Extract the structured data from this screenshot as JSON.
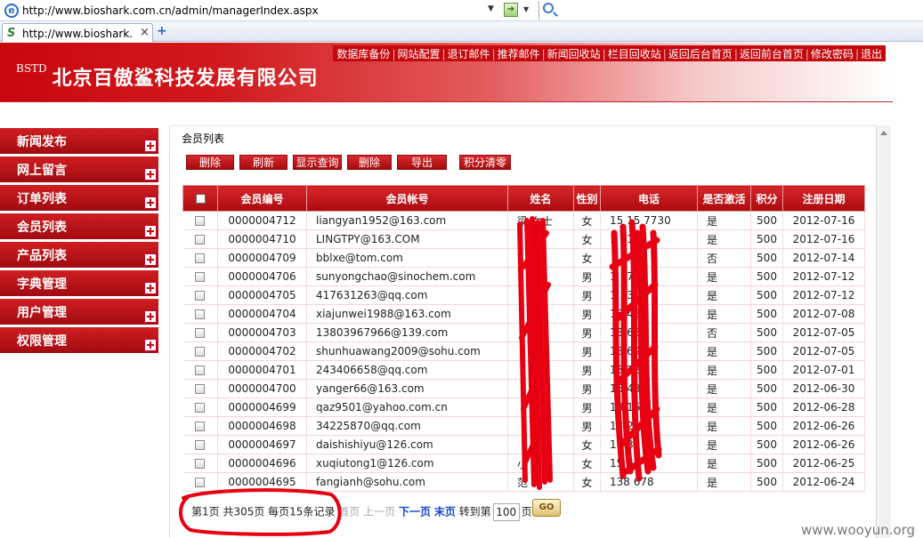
{
  "browser": {
    "url": "http://www.bioshark.com.cn/admin/managerIndex.aspx",
    "tab_title": "http://www.bioshark.",
    "tab_close": "×",
    "new_tab": "+"
  },
  "header": {
    "top_links": [
      "数据库备份",
      "网站配置",
      "退订邮件",
      "推荐邮件",
      "新闻回收站",
      "栏目回收站",
      "返回后台首页",
      "返回前台首页",
      "修改密码",
      "退出"
    ],
    "brand_short": "BSTD",
    "company_name": "北京百傲鲨科技发展有限公司"
  },
  "sidebar": {
    "items": [
      "新闻发布",
      "网上留言",
      "订单列表",
      "会员列表",
      "产品列表",
      "字典管理",
      "用户管理",
      "权限管理"
    ]
  },
  "main": {
    "title": "会员列表",
    "toolbar": [
      "删除",
      "刷新",
      "显示查询",
      "删除",
      "导出",
      "积分清零"
    ],
    "columns": [
      "",
      "会员编号",
      "会员帐号",
      "姓名",
      "性别",
      "电话",
      "是否激活",
      "积分",
      "注册日期"
    ],
    "rows": [
      [
        "0000004712",
        "liangyan1952@163.com",
        "梁 女士",
        "女",
        "15 15 7730",
        "是",
        "500",
        "2012-07-16"
      ],
      [
        "0000004710",
        "LINGTPY@163.COM",
        "",
        "女",
        "1 8103",
        "是",
        "500",
        "2012-07-16"
      ],
      [
        "0000004709",
        "bblxe@tom.com",
        "",
        "女",
        "",
        "否",
        "500",
        "2012-07-14"
      ],
      [
        "0000004706",
        "sunyongchao@sinochem.com",
        "",
        "男",
        "1 77",
        "是",
        "500",
        "2012-07-12"
      ],
      [
        "0000004705",
        "417631263@qq.com",
        "",
        "男",
        "1 23",
        "是",
        "500",
        "2012-07-12"
      ],
      [
        "0000004704",
        "xiajunwei1988@163.com",
        "",
        "男",
        "15 48",
        "是",
        "500",
        "2012-07-08"
      ],
      [
        "0000004703",
        "13803967966@139.com",
        "",
        "男",
        "13 66",
        "否",
        "500",
        "2012-07-05"
      ],
      [
        "0000004702",
        "shunhuawang2009@sohu.com",
        "",
        "男",
        "13 69",
        "是",
        "500",
        "2012-07-05"
      ],
      [
        "0000004701",
        "243406658@qq.com",
        "",
        "男",
        "13 22",
        "是",
        "500",
        "2012-07-01"
      ],
      [
        "0000004700",
        "yanger66@163.com",
        "",
        "男",
        "15 48",
        "是",
        "500",
        "2012-06-30"
      ],
      [
        "0000004699",
        "qaz9501@yahoo.com.cn",
        "",
        "男",
        "18 16",
        "是",
        "500",
        "2012-06-28"
      ],
      [
        "0000004698",
        "34225870@qq.com",
        "",
        "男",
        "13 21",
        "是",
        "500",
        "2012-06-26"
      ],
      [
        "0000004697",
        "daishishiyu@126.com",
        "",
        "女",
        "18 33",
        "是",
        "500",
        "2012-06-26"
      ],
      [
        "0000004696",
        "xuqiutong1@126.com",
        "小",
        "女",
        "15 67",
        "是",
        "500",
        "2012-06-25"
      ],
      [
        "0000004695",
        "fangianh@sohu.com",
        "范",
        "女",
        "138 678",
        "是",
        "500",
        "2012-06-24"
      ]
    ]
  },
  "pager": {
    "summary": "第1页 共305页 每页15条记录",
    "first": "首页",
    "prev": "上一页",
    "next": "下一页",
    "last": "末页",
    "goto_label": "转到第",
    "page_input": "100",
    "page_suffix": "页",
    "go_label": "GO"
  },
  "watermark": "www.wooyun.org",
  "colors": {
    "brand_red": "#c4070c",
    "scribble_red": "#e60012"
  },
  "icons": [
    "ie-icon",
    "go-arrow-icon",
    "search-icon",
    "favicon-icon",
    "plus-icon",
    "checkbox-icon"
  ]
}
